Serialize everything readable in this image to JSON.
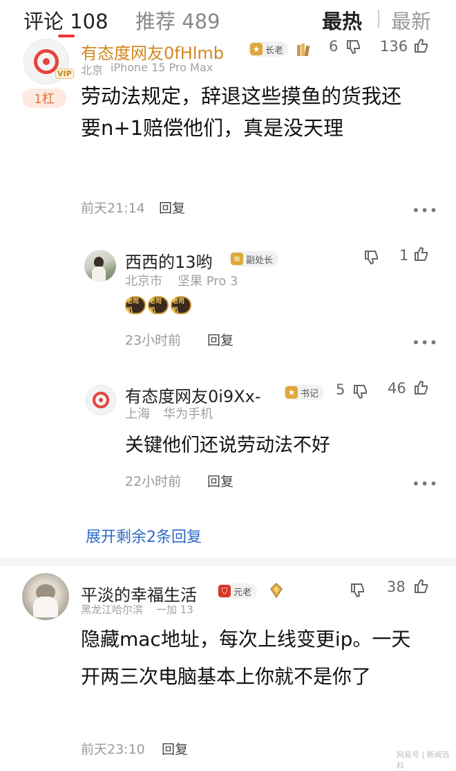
{
  "header": {
    "comments_label": "评论 108",
    "recommend_label": "推荐 489",
    "hot_label": "最热",
    "new_label": "最新"
  },
  "comment1": {
    "username": "有态度网友0fHlmb",
    "badge": "长老",
    "vip": "VIP",
    "location": "北京",
    "device": "iPhone 15 Pro Max",
    "dislikes": "6",
    "likes": "136",
    "rank": "1杠",
    "text": "劳动法规定，辞退这些摸鱼的货我还要n+1赔偿他们，真是没天理",
    "time": "前天21:14",
    "reply": "回复",
    "more": "•••"
  },
  "reply1": {
    "username": "西西的13哟",
    "badge": "副处长",
    "location": "北京市",
    "device": "坚果 Pro 3",
    "likes": "1",
    "stickers": [
      "老司机",
      "老司机",
      "老司机"
    ],
    "time": "23小时前",
    "reply": "回复",
    "more": "•••"
  },
  "reply2": {
    "username": "有态度网友0i9Xx-",
    "badge": "书记",
    "location": "上海",
    "device": "华为手机",
    "dislikes": "5",
    "likes": "46",
    "text": "关键他们还说劳动法不好",
    "time": "22小时前",
    "reply": "回复",
    "more": "•••"
  },
  "expand_label": "展开剩余2条回复",
  "comment2": {
    "username": "平淡的幸福生活",
    "badge": "元老",
    "location": "黑龙江哈尔滨",
    "device": "一加 13",
    "likes": "38",
    "text": "隐藏mac地址，每次上线变更ip。一天开两三次电脑基本上你就不是你了",
    "time": "前天23:10",
    "reply": "回复"
  },
  "watermark": "网易号 | 新闻百科"
}
